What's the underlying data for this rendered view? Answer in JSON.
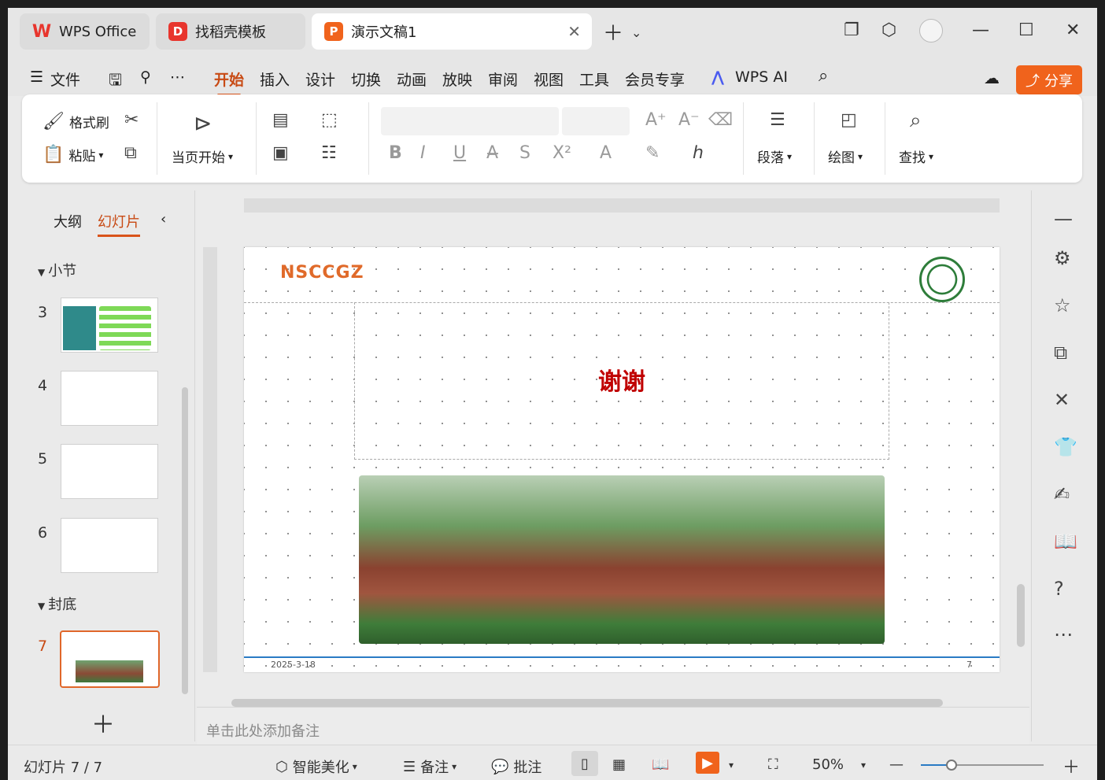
{
  "tabs": [
    {
      "label": "WPS Office",
      "icon": "wps-logo-icon"
    },
    {
      "label": "找稻壳模板",
      "icon": "docer-icon"
    },
    {
      "label": "演示文稿1",
      "icon": "presentation-icon"
    }
  ],
  "menu": {
    "file": "文件",
    "items": [
      "开始",
      "插入",
      "设计",
      "切换",
      "动画",
      "放映",
      "审阅",
      "视图",
      "工具",
      "会员专享"
    ],
    "ai": "WPS AI",
    "share": "分享"
  },
  "ribbon": {
    "format_painter": "格式刷",
    "paste": "粘贴",
    "play_from_current": "当页开始",
    "paragraph": "段落",
    "drawing": "绘图",
    "find": "查找"
  },
  "left_panel": {
    "tab_outline": "大纲",
    "tab_slides": "幻灯片",
    "section1": "小节",
    "section2": "封底",
    "slides": [
      "3",
      "4",
      "5",
      "6",
      "7"
    ],
    "selected_slide": "7"
  },
  "slide": {
    "title": "谢谢",
    "date": "2025-3-18",
    "page_number": "7",
    "logo_left": "NSCCGZ"
  },
  "notes_placeholder": "单击此处添加备注",
  "status": {
    "slide_counter": "幻灯片 7 / 7",
    "beautify": "智能美化",
    "notes": "备注",
    "comment": "批注",
    "zoom": "50%"
  },
  "colors": {
    "accent": "#f0631c",
    "title_red": "#c00000"
  }
}
